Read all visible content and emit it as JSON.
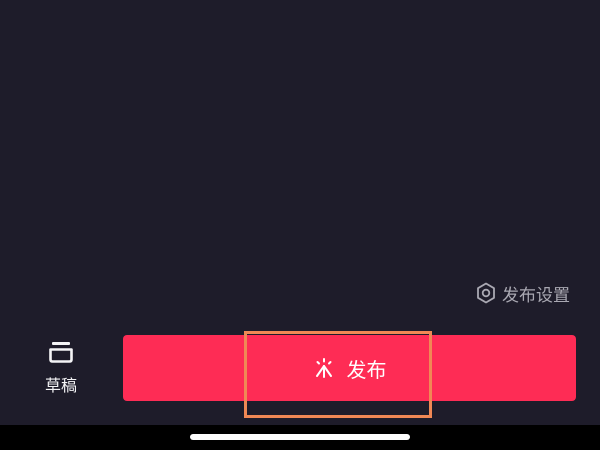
{
  "publish_settings": {
    "label": "发布设置",
    "icon": "settings-hexagon-icon"
  },
  "draft": {
    "label": "草稿",
    "icon": "draft-box-icon"
  },
  "publish_button": {
    "label": "发布",
    "icon": "sparkle-icon"
  },
  "colors": {
    "background": "#1e1c2a",
    "primary_button": "#fe2c55",
    "highlight_border": "#f08855",
    "secondary_text": "#a9a8b2"
  }
}
